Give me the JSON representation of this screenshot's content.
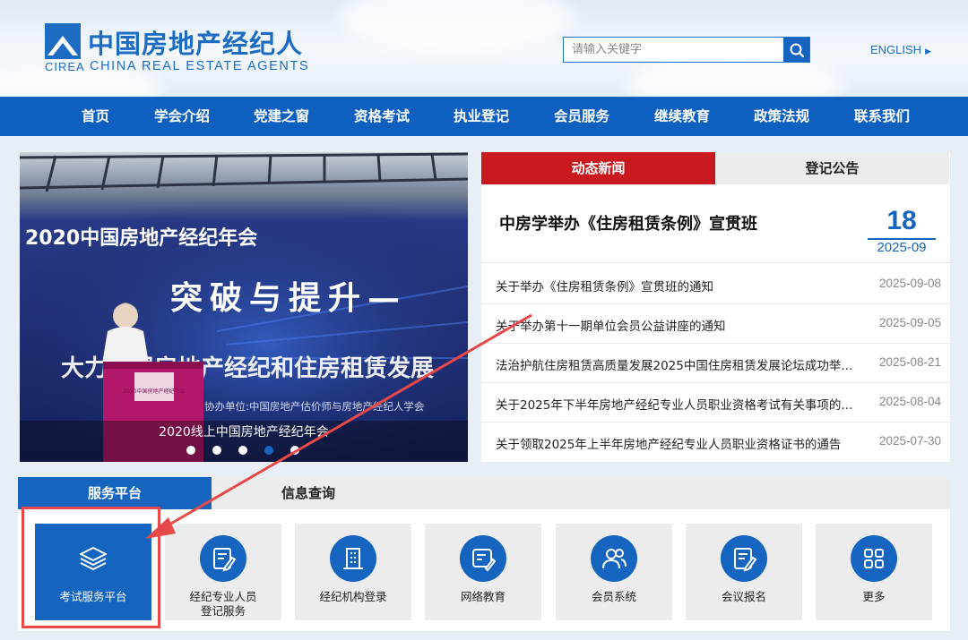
{
  "header": {
    "logo_cn": "中国房地产经纪人",
    "logo_abbr": "CIREA",
    "logo_en": "CHINA REAL ESTATE AGENTS",
    "search_placeholder": "请输入关键字",
    "language_link": "ENGLISH"
  },
  "nav": {
    "items": [
      "首页",
      "学会介绍",
      "党建之窗",
      "资格考试",
      "执业登记",
      "会员服务",
      "继续教育",
      "政策法规",
      "联系我们"
    ]
  },
  "carousel": {
    "slide_banner_year": "2020中国房地产经纪年会",
    "slide_banner_slogan": "突破与提升—",
    "slide_banner_sub": "大力发展房地产经纪和住房租赁发展",
    "slide_organizer": "协办单位:中国房地产估价师与房地产经纪人学会",
    "caption": "2020线上中国房地产经纪年会",
    "dot_count": 5,
    "active_dot": 3
  },
  "news": {
    "tabs": [
      "动态新闻",
      "登记公告"
    ],
    "active_tab": 0,
    "headline": {
      "title": "中房学举办《住房租赁条例》宣贯班",
      "day": "18",
      "year_month": "2025-09"
    },
    "items": [
      {
        "title": "关于举办《住房租赁条例》宣贯班的通知",
        "date": "2025-09-08"
      },
      {
        "title": "关于举办第十一期单位会员公益讲座的通知",
        "date": "2025-09-05"
      },
      {
        "title": "法治护航住房租赁高质量发展2025中国住房租赁发展论坛成功举...",
        "date": "2025-08-21"
      },
      {
        "title": "关于2025年下半年房地产经纪专业人员职业资格考试有关事项的...",
        "date": "2025-08-04"
      },
      {
        "title": "关于领取2025年上半年房地产经纪专业人员职业资格证书的通告",
        "date": "2025-07-30"
      }
    ]
  },
  "services": {
    "tabs": [
      "服务平台",
      "信息查询"
    ],
    "active_tab": 0,
    "tiles": [
      {
        "label": "考试服务平台",
        "icon": "layers-icon"
      },
      {
        "label": "经纪专业人员\n登记服务",
        "icon": "document-edit-icon"
      },
      {
        "label": "经纪机构登录",
        "icon": "building-icon"
      },
      {
        "label": "网络教育",
        "icon": "online-course-icon"
      },
      {
        "label": "会员系统",
        "icon": "users-icon"
      },
      {
        "label": "会议报名",
        "icon": "signup-form-icon"
      },
      {
        "label": "更多",
        "icon": "grid-icon"
      }
    ]
  },
  "colors": {
    "brand_blue": "#1565c0",
    "nav_blue": "#0d5fc0",
    "news_red": "#c9191e",
    "annotation_red": "#e84848"
  }
}
